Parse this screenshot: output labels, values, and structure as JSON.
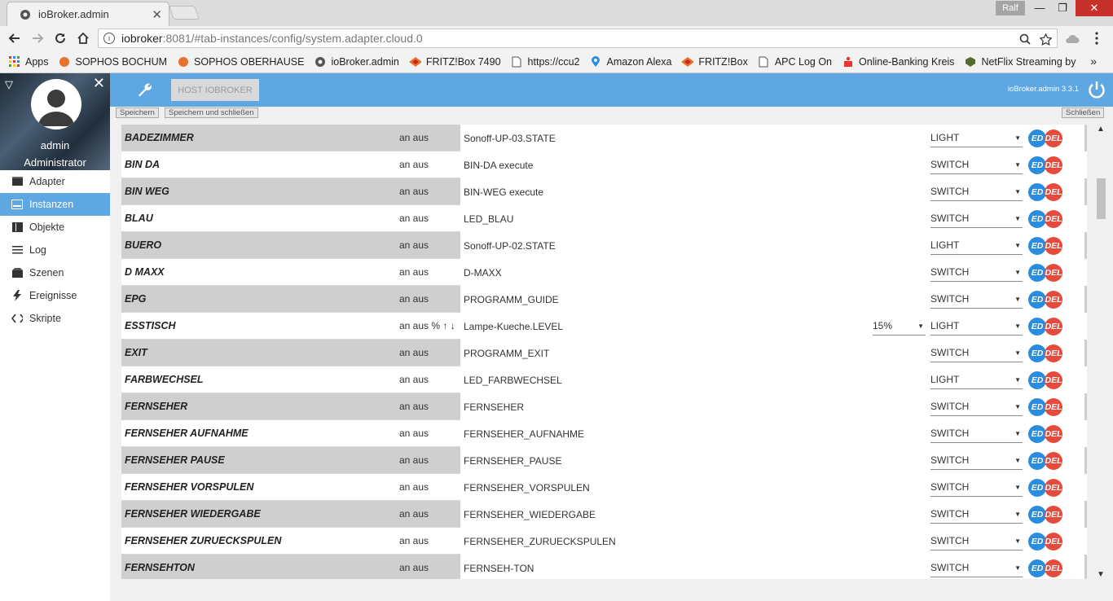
{
  "browser": {
    "tab_title": "ioBroker.admin",
    "tab_close": "✕",
    "profile": "Ralf",
    "minimize": "—",
    "maximize": "❐",
    "close": "✕",
    "url_host": "iobroker",
    "url_path": ":8081/#tab-instances/config/system.adapter.cloud.0"
  },
  "bookmarks": [
    {
      "label": "Apps",
      "icon": "apps-grid-icon",
      "color": "#d33"
    },
    {
      "label": "SOPHOS BOCHUM",
      "icon": "sophos-icon",
      "color": "#e8712c"
    },
    {
      "label": "SOPHOS OBERHAUSE",
      "icon": "sophos-icon",
      "color": "#e8712c"
    },
    {
      "label": "ioBroker.admin",
      "icon": "gear-icon",
      "color": "#555"
    },
    {
      "label": "FRITZ!Box 7490",
      "icon": "fritz-icon",
      "color": "#c22"
    },
    {
      "label": "https://ccu2",
      "icon": "document-icon",
      "color": "#555"
    },
    {
      "label": "Amazon Alexa",
      "icon": "map-pin-icon",
      "color": "#2a8cde"
    },
    {
      "label": "FRITZ!Box",
      "icon": "fritz-icon",
      "color": "#c22"
    },
    {
      "label": "APC  Log On",
      "icon": "document-icon",
      "color": "#555"
    },
    {
      "label": "Online-Banking  Kreis",
      "icon": "bank-icon",
      "color": "#e33"
    },
    {
      "label": "NetFlix Streaming by",
      "icon": "netflix-icon",
      "color": "#556b2f"
    }
  ],
  "bookmarks_more": "»",
  "sidebar": {
    "user_name": "admin",
    "user_role": "Administrator",
    "toggle": "▽",
    "close": "✕",
    "items": [
      {
        "label": "Adapter",
        "icon": "store-icon",
        "active": false
      },
      {
        "label": "Instanzen",
        "icon": "instances-icon",
        "active": true
      },
      {
        "label": "Objekte",
        "icon": "objects-icon",
        "active": false
      },
      {
        "label": "Log",
        "icon": "list-icon",
        "active": false
      },
      {
        "label": "Szenen",
        "icon": "scenes-icon",
        "active": false
      },
      {
        "label": "Ereignisse",
        "icon": "lightning-icon",
        "active": false
      },
      {
        "label": "Skripte",
        "icon": "code-icon",
        "active": false
      }
    ]
  },
  "header": {
    "host_button": "HOST IOBROKER",
    "version": "ioBroker.admin 3.3.1"
  },
  "buttons": {
    "save": "Speichern",
    "save_close": "Speichern und schließen",
    "close": "Schließen"
  },
  "row_buttons": {
    "edit": "ED",
    "delete": "DEL"
  },
  "rows": [
    {
      "name": "BADEZIMMER",
      "desc": "an aus",
      "state": "Sonoff-UP-03.STATE",
      "type": "LIGHT",
      "pct": ""
    },
    {
      "name": "BIN DA",
      "desc": "an aus",
      "state": "BIN-DA execute",
      "type": "SWITCH",
      "pct": ""
    },
    {
      "name": "BIN WEG",
      "desc": "an aus",
      "state": "BIN-WEG execute",
      "type": "SWITCH",
      "pct": ""
    },
    {
      "name": "BLAU",
      "desc": "an aus",
      "state": "LED_BLAU",
      "type": "SWITCH",
      "pct": ""
    },
    {
      "name": "BUERO",
      "desc": "an aus",
      "state": "Sonoff-UP-02.STATE",
      "type": "LIGHT",
      "pct": ""
    },
    {
      "name": "D MAXX",
      "desc": "an aus",
      "state": "D-MAXX",
      "type": "SWITCH",
      "pct": ""
    },
    {
      "name": "EPG",
      "desc": "an aus",
      "state": "PROGRAMM_GUIDE",
      "type": "SWITCH",
      "pct": ""
    },
    {
      "name": "ESSTISCH",
      "desc": "an aus % ↑ ↓",
      "state": "Lampe-Kueche.LEVEL",
      "type": "LIGHT",
      "pct": "15%"
    },
    {
      "name": "EXIT",
      "desc": "an aus",
      "state": "PROGRAMM_EXIT",
      "type": "SWITCH",
      "pct": ""
    },
    {
      "name": "FARBWECHSEL",
      "desc": "an aus",
      "state": "LED_FARBWECHSEL",
      "type": "LIGHT",
      "pct": ""
    },
    {
      "name": "FERNSEHER",
      "desc": "an aus",
      "state": "FERNSEHER",
      "type": "SWITCH",
      "pct": ""
    },
    {
      "name": "FERNSEHER AUFNAHME",
      "desc": "an aus",
      "state": "FERNSEHER_AUFNAHME",
      "type": "SWITCH",
      "pct": ""
    },
    {
      "name": "FERNSEHER PAUSE",
      "desc": "an aus",
      "state": "FERNSEHER_PAUSE",
      "type": "SWITCH",
      "pct": ""
    },
    {
      "name": "FERNSEHER VORSPULEN",
      "desc": "an aus",
      "state": "FERNSEHER_VORSPULEN",
      "type": "SWITCH",
      "pct": ""
    },
    {
      "name": "FERNSEHER WIEDERGABE",
      "desc": "an aus",
      "state": "FERNSEHER_WIEDERGABE",
      "type": "SWITCH",
      "pct": ""
    },
    {
      "name": "FERNSEHER ZURUECKSPULEN",
      "desc": "an aus",
      "state": "FERNSEHER_ZURUECKSPULEN",
      "type": "SWITCH",
      "pct": ""
    },
    {
      "name": "FERNSEHTON",
      "desc": "an aus",
      "state": "FERNSEH-TON",
      "type": "SWITCH",
      "pct": ""
    }
  ],
  "colors": {
    "accent": "#5fa7e2",
    "edit": "#2a8cde",
    "delete": "#e54b3c",
    "row_alt": "#cfcfcf"
  }
}
